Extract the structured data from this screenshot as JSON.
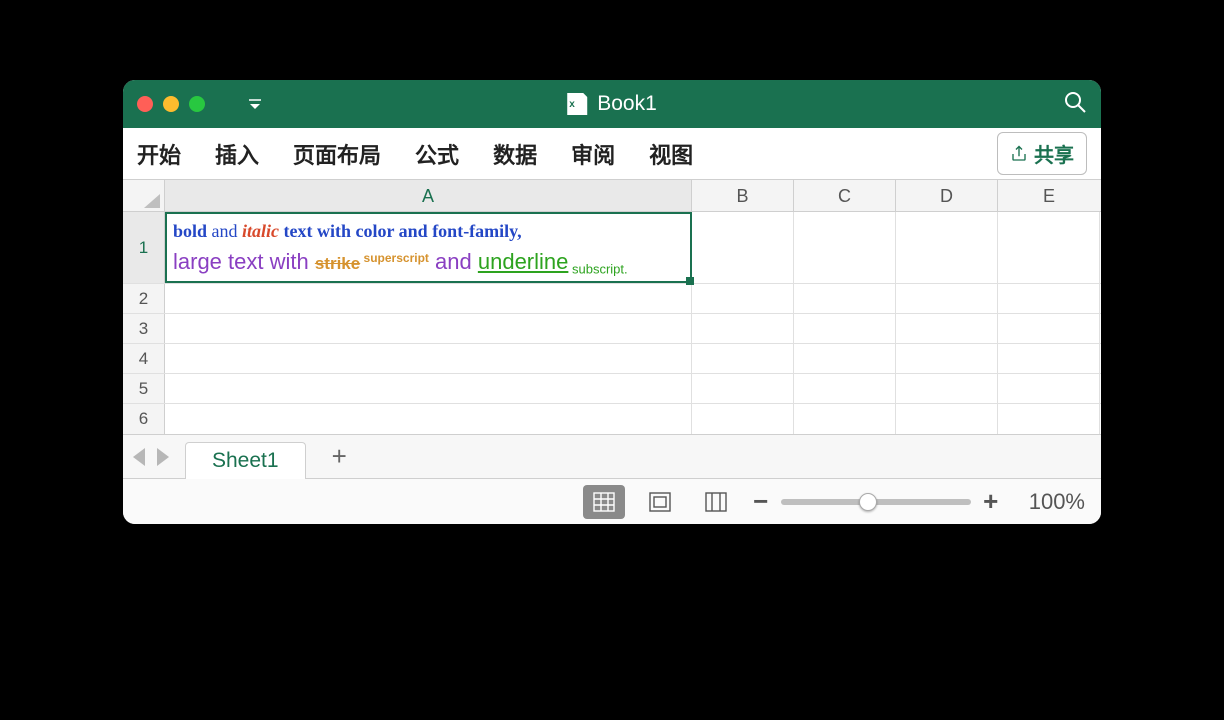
{
  "title": "Book1",
  "ribbon": {
    "tabs": [
      "开始",
      "插入",
      "页面布局",
      "公式",
      "数据",
      "审阅",
      "视图"
    ],
    "share": "共享"
  },
  "columns": [
    "A",
    "B",
    "C",
    "D",
    "E"
  ],
  "rows": [
    "1",
    "2",
    "3",
    "4",
    "5",
    "6"
  ],
  "cell_A1": {
    "line1": {
      "bold": "bold",
      "and": " and ",
      "italic": "italic",
      "rest": "  text with color and font-family,"
    },
    "line2": {
      "large": "large text with ",
      "strike": "strike",
      "sup": " superscript",
      "and": " and ",
      "under": "underline",
      "sub": " subscript."
    }
  },
  "sheet_tab": "Sheet1",
  "zoom": "100%"
}
